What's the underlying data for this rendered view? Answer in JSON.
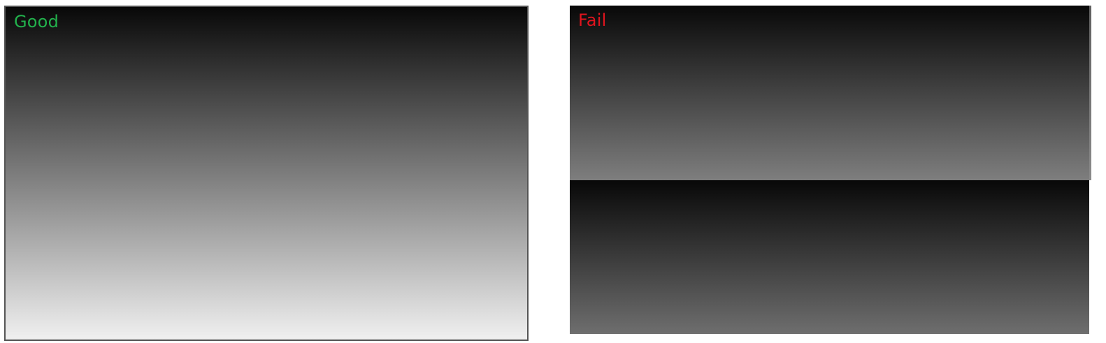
{
  "panels": {
    "good": {
      "label": "Good",
      "label_color": "#22b14c"
    },
    "fail": {
      "label": "Fail",
      "label_color": "#e0141e"
    }
  }
}
